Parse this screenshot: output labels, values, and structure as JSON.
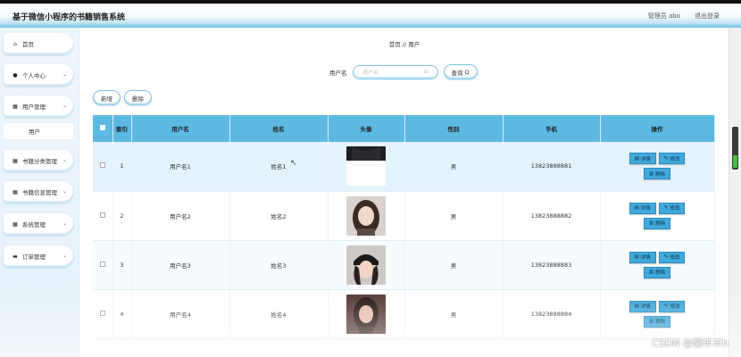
{
  "header": {
    "title": "基于微信小程序的书籍销售系统",
    "admin_label": "管理员 abo",
    "logout_label": "退出登录"
  },
  "sidebar": {
    "items": [
      {
        "label": "首页",
        "icon": "home-icon",
        "has_arrow": false
      },
      {
        "label": "个人中心",
        "icon": "user-icon",
        "has_arrow": true
      },
      {
        "label": "用户管理",
        "icon": "grid-icon",
        "has_arrow": true
      },
      {
        "label": "书籍分类管理",
        "icon": "grid-icon",
        "has_arrow": true
      },
      {
        "label": "书籍信息管理",
        "icon": "grid-icon",
        "has_arrow": true
      },
      {
        "label": "系统管理",
        "icon": "grid-icon",
        "has_arrow": true
      },
      {
        "label": "订单管理",
        "icon": "monitor-icon",
        "has_arrow": true
      }
    ],
    "sub_item": "用户"
  },
  "breadcrumb": {
    "home": "首页",
    "separator": "//",
    "current": "用户"
  },
  "search": {
    "label": "用户名",
    "placeholder": "用户名",
    "button_label": "查询"
  },
  "actions": {
    "add_label": "新增",
    "delete_label": "删除"
  },
  "table": {
    "headers": [
      "索引",
      "用户名",
      "姓名",
      "头像",
      "性别",
      "手机",
      "操作"
    ],
    "rows": [
      {
        "index": "1",
        "username": "用户名1",
        "name": "姓名1",
        "gender": "男",
        "phone": "13823888881"
      },
      {
        "index": "2",
        "username": "用户名2",
        "name": "姓名2",
        "gender": "男",
        "phone": "13823888882"
      },
      {
        "index": "3",
        "username": "用户名3",
        "name": "姓名3",
        "gender": "男",
        "phone": "13823888883"
      },
      {
        "index": "4",
        "username": "用户名4",
        "name": "姓名4",
        "gender": "男",
        "phone": "13823888884"
      }
    ],
    "op_labels": {
      "detail": "详情",
      "edit": "修改",
      "delete": "删除"
    }
  },
  "watermark": "CSDN @懒羊羊h",
  "colors": {
    "accent": "#5cb9e2",
    "button": "#41a9dc",
    "border": "#7fc4e4"
  }
}
